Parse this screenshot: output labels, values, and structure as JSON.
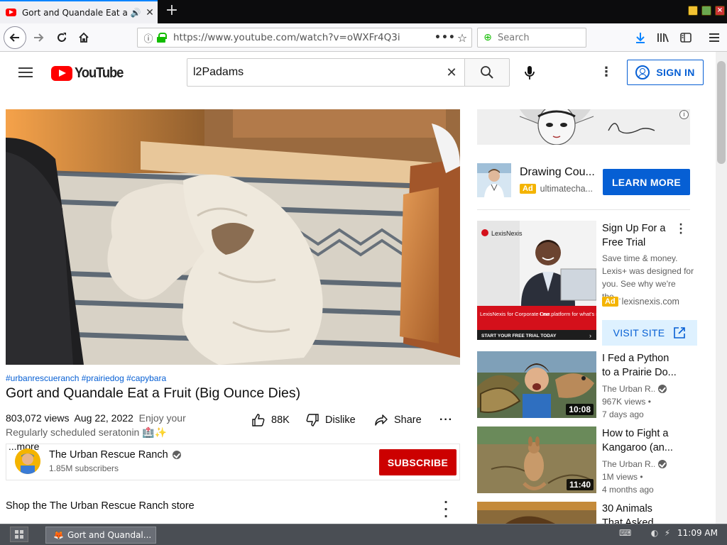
{
  "browser": {
    "tab_title": "Gort and Quandale Eat a Fruit (Big Ounce Dies) - YouTube",
    "new_tab_label": "+",
    "url": "https://www.youtube.com/watch?v=oWXFr4Q3i",
    "search_placeholder": "Search"
  },
  "youtube": {
    "logo_text": "YouTube",
    "search_query": "l2Padams",
    "sign_in_label": "SIGN IN"
  },
  "video": {
    "hashtags": "#urbanrescueranch #prairiedog #capybara",
    "title": "Gort and Quandale Eat a Fruit (Big Ounce Dies)",
    "views": "803,072 views",
    "date": "Aug 22, 2022",
    "desc_prefix": "Enjoy your",
    "desc_line2": "Regularly scheduled seratonin",
    "desc_emoji": "🏥✨",
    "more_label": "...more",
    "likes": "88K",
    "dislike_label": "Dislike",
    "share_label": "Share",
    "more_actions": "···"
  },
  "channel": {
    "name": "The Urban Rescue Ranch",
    "subscribers": "1.85M subscribers",
    "subscribe_label": "SUBSCRIBE"
  },
  "shop": {
    "title": "Shop the The Urban Rescue Ranch store"
  },
  "ads": {
    "ad1": {
      "title": "Drawing Cou...",
      "badge": "Ad",
      "domain": "ultimatecha...",
      "cta": "LEARN MORE"
    },
    "ad2": {
      "title": "Sign Up For a Free Trial",
      "description": "Save time & money. Lexis+ was designed for you. See why we're the...",
      "badge": "Ad",
      "domain": "lexisnexis.com",
      "cta": "VISIT SITE",
      "image_brand": "LexisNexis",
      "image_tag1": "LexisNexis for Corporate Law.",
      "image_tag2": "One platform for what's next.",
      "image_cta": "START YOUR FREE TRIAL TODAY"
    }
  },
  "recommendations": [
    {
      "title_line1": "I Fed a Python",
      "title_line2": "to a Prairie Do...",
      "channel": "The Urban R...",
      "views": "967K views •",
      "age": "7 days ago",
      "duration": "10:08"
    },
    {
      "title_line1": "How to Fight a",
      "title_line2": "Kangaroo (an...",
      "channel": "The Urban R...",
      "views": "1M views •",
      "age": "4 months ago",
      "duration": "11:40"
    },
    {
      "title_line1": "30 Animals",
      "title_line2": "That Asked..."
    }
  ],
  "taskbar": {
    "task_label": "Gort and Quandal...",
    "clock": "11:09 AM"
  },
  "colors": {
    "youtube_red": "#ff0000",
    "subscribe_red": "#cc0000",
    "link_blue": "#065fd4",
    "ad_badge": "#f4b400"
  }
}
